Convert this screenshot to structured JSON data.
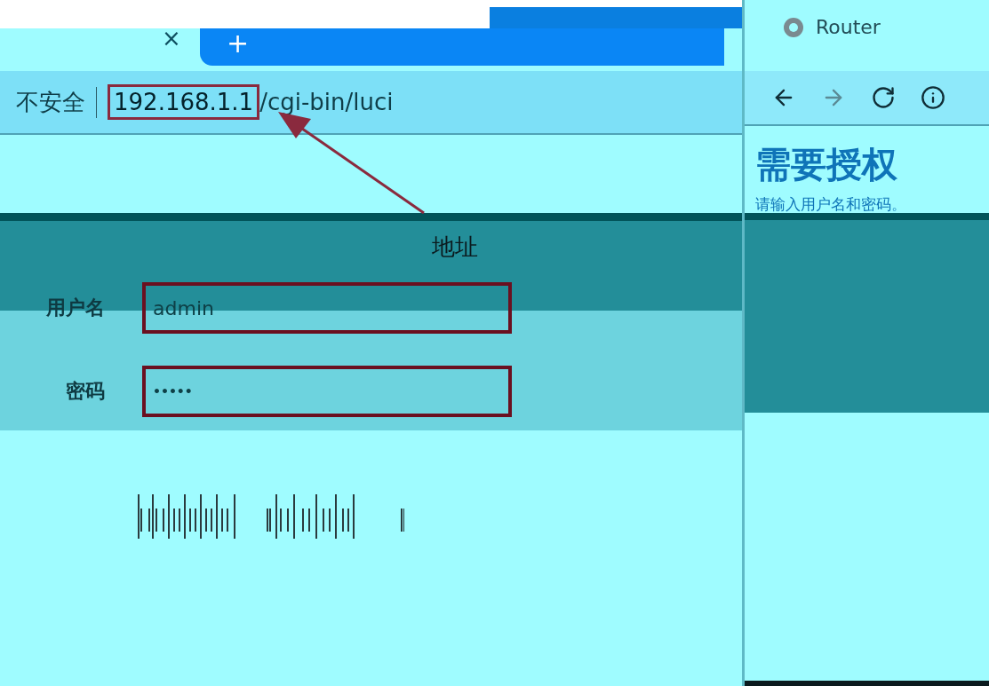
{
  "browser": {
    "tab": {
      "close": "×",
      "new_tab": "+"
    },
    "address_bar": {
      "security_label": "不安全",
      "url_host": "192.168.1.1",
      "url_path": "/cgi-bin/luci",
      "host_highlighted": true
    }
  },
  "annotation": {
    "label": "地址"
  },
  "login_form": {
    "fields": [
      {
        "label": "用户名",
        "value": "admin",
        "kind": "text",
        "highlighted": true
      },
      {
        "label": "密码",
        "value": "•••••",
        "kind": "password",
        "highlighted": true
      }
    ]
  },
  "side_window": {
    "tab_title": "Router",
    "heading": "需要授权",
    "subtitle": "请输入用户名和密码。"
  }
}
